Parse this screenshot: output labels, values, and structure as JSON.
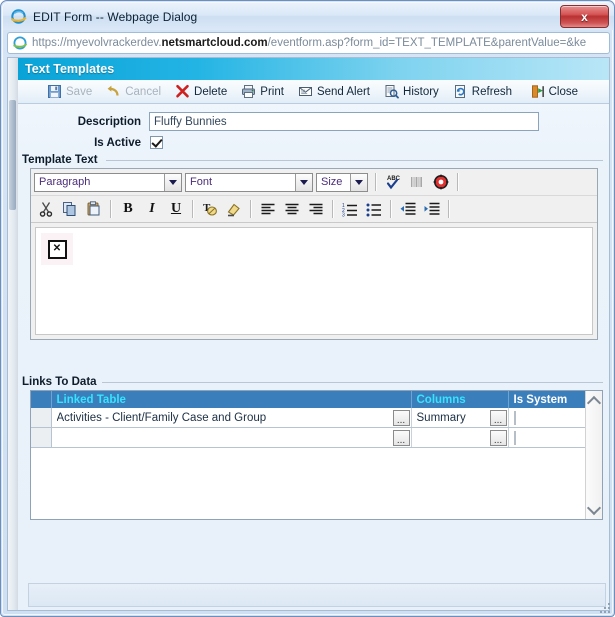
{
  "window": {
    "title": "EDIT Form -- Webpage Dialog",
    "icon": "ie-browser-icon",
    "close_label": "x"
  },
  "address_bar": {
    "icon": "ie-browser-icon",
    "url_prefix": "https://myevolvrackerdev.",
    "url_domain": "netsmartcloud.com",
    "url_suffix": "/eventform.asp?form_id=TEXT_TEMPLATE&parentValue=&ke"
  },
  "app": {
    "header_title": "Text Templates",
    "toolbar": [
      {
        "label": "Save",
        "icon": "save-disk-icon",
        "name": "save-button",
        "disabled": true
      },
      {
        "label": "Cancel",
        "icon": "undo-arrow-icon",
        "name": "cancel-button",
        "disabled": true
      },
      {
        "label": "Delete",
        "icon": "red-x-icon",
        "name": "delete-button",
        "disabled": false
      },
      {
        "label": "Print",
        "icon": "printer-icon",
        "name": "print-button",
        "disabled": false
      },
      {
        "label": "Send Alert",
        "icon": "envelope-icon",
        "name": "send-alert-button",
        "disabled": false
      },
      {
        "label": "History",
        "icon": "history-icon",
        "name": "history-button",
        "disabled": false
      },
      {
        "label": "Refresh",
        "icon": "refresh-page-icon",
        "name": "refresh-button",
        "disabled": false
      }
    ],
    "close_button": {
      "label": "Close",
      "icon": "exit-door-icon"
    }
  },
  "form": {
    "description_label": "Description",
    "description_value": "Fluffy Bunnies",
    "description_placeholder": "",
    "is_active_label": "Is Active",
    "is_active_checked": true
  },
  "template_text": {
    "caption": "Template Text",
    "row1": {
      "paragraph_select": "Paragraph",
      "font_select": "Font",
      "size_select": "Size",
      "buttons": [
        {
          "label": "ABC",
          "icon": "spellcheck-icon",
          "name": "spellcheck-button",
          "disabled": false
        },
        {
          "label": "",
          "icon": "barcode-icon",
          "name": "barcode-button",
          "disabled": true
        },
        {
          "label": "",
          "icon": "timestamp-clock-icon",
          "name": "timestamp-button",
          "disabled": false
        }
      ]
    },
    "row2": [
      {
        "icon": "cut-scissors-icon",
        "name": "cut-button"
      },
      {
        "icon": "copy-icon",
        "name": "copy-button"
      },
      {
        "icon": "paste-clipboard-icon",
        "name": "paste-button"
      },
      {
        "icon": "bold-icon",
        "name": "bold-button",
        "glyph": "B"
      },
      {
        "icon": "italic-icon",
        "name": "italic-button",
        "glyph": "I"
      },
      {
        "icon": "underline-icon",
        "name": "underline-button",
        "glyph": "U"
      },
      {
        "icon": "text-color-icon",
        "name": "text-color-button"
      },
      {
        "icon": "highlight-color-icon",
        "name": "highlight-color-button"
      },
      {
        "icon": "align-left-icon",
        "name": "align-left-button"
      },
      {
        "icon": "align-center-icon",
        "name": "align-center-button"
      },
      {
        "icon": "align-right-icon",
        "name": "align-right-button"
      },
      {
        "icon": "numbered-list-icon",
        "name": "ordered-list-button"
      },
      {
        "icon": "bulleted-list-icon",
        "name": "unordered-list-button"
      },
      {
        "icon": "outdent-icon",
        "name": "outdent-button"
      },
      {
        "icon": "indent-icon",
        "name": "indent-button"
      }
    ],
    "content_icon": "broken-image-icon",
    "content_glyph": "☒",
    "content_value": ""
  },
  "links_to_data": {
    "caption": "Links To Data",
    "columns": [
      {
        "label": "",
        "name": "row-selector-column",
        "accent": "none"
      },
      {
        "label": "Linked Table",
        "name": "linked-table-column",
        "accent": "cyan"
      },
      {
        "label": "Columns",
        "name": "columns-column",
        "accent": "cyan"
      },
      {
        "label": "Is System",
        "name": "is-system-column",
        "accent": "white"
      }
    ],
    "rows": [
      {
        "linked_table": "Activities - Client/Family Case and Group",
        "columns": "Summary",
        "is_system": false
      },
      {
        "linked_table": "",
        "columns": "",
        "is_system": false
      }
    ],
    "ellipsis_label": "...",
    "scroll_up_icon": "chevron-up-icon",
    "scroll_down_icon": "chevron-down-icon"
  },
  "colors": {
    "header_start": "#0aa3d8",
    "header_end": "#b9e6f7",
    "grid_header": "#3a7ebc",
    "grid_header_accent": "#37e3ff",
    "close_red": "#b93232"
  }
}
